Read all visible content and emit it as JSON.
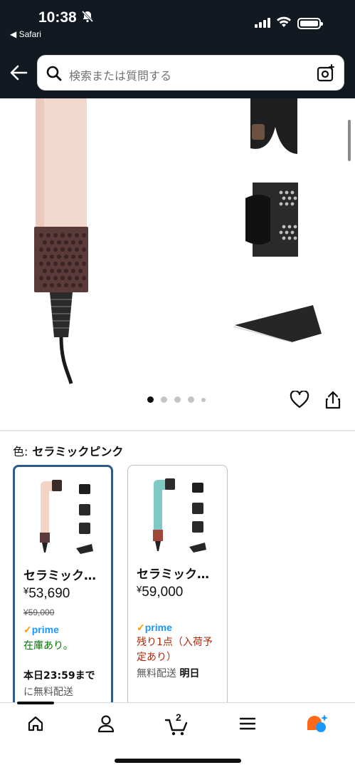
{
  "status_bar": {
    "time": "10:38",
    "back_app": "◀ Safari"
  },
  "header": {
    "search_placeholder": "検索または質問する"
  },
  "gallery": {
    "dots_total": 5,
    "active_dot": 0
  },
  "color_selector": {
    "label": "色:",
    "selected_value": "セラミックピンク"
  },
  "variants": [
    {
      "title": "セラミック…",
      "price_symbol": "¥",
      "price": "53,690",
      "list_price": "¥59,000",
      "prime": "prime",
      "stock": "在庫あり。",
      "delivery_line1": "本日23:59まで",
      "delivery_line2": "に無料配送",
      "selected": true
    },
    {
      "title": "セラミック…",
      "price_symbol": "¥",
      "price": "59,000",
      "prime": "prime",
      "stock": "残り1点（入荷予定あり）",
      "delivery_prefix": "無料配送",
      "delivery_bold": "明日",
      "selected": false
    }
  ],
  "tabbar": {
    "cart_count": "2",
    "items": [
      "home-icon",
      "account-icon",
      "cart-icon",
      "menu-icon",
      "rufus-assistant-icon"
    ]
  },
  "colors": {
    "header_bg": "#131921",
    "selected_border": "#2e5c86",
    "prime_blue": "#1a98ff",
    "prime_orange": "#ff9900",
    "in_stock_green": "#007600",
    "low_stock_red": "#b12704"
  }
}
